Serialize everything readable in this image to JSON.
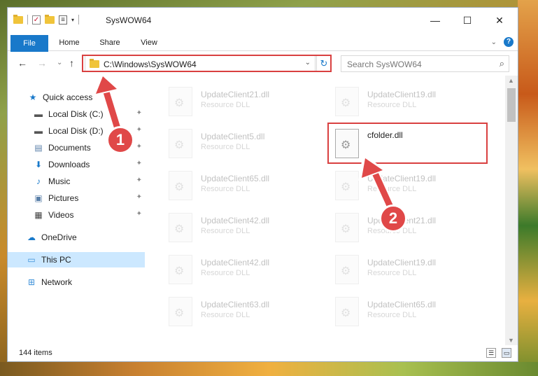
{
  "window": {
    "title": "SysWOW64",
    "minimize": "—",
    "maximize": "☐",
    "close": "✕"
  },
  "ribbon": {
    "tabs": [
      "File",
      "Home",
      "Share",
      "View"
    ],
    "expand": "⌄",
    "help": "?"
  },
  "nav": {
    "back": "←",
    "forward": "→",
    "recent": "⌄",
    "up": "↑",
    "address": "C:\\Windows\\SysWOW64",
    "address_dropdown": "⌄",
    "refresh": "↻",
    "search_placeholder": "Search SysWOW64",
    "search_icon": "⌕"
  },
  "sidebar": {
    "items": [
      {
        "label": "Quick access",
        "icon": "star-icon",
        "glyph": "★"
      },
      {
        "label": "Local Disk (C:)",
        "icon": "drive-icon",
        "glyph": "▬",
        "pin": "📌"
      },
      {
        "label": "Local Disk (D:)",
        "icon": "drive-icon",
        "glyph": "▬",
        "pin": "📌"
      },
      {
        "label": "Documents",
        "icon": "documents-icon",
        "glyph": "▤",
        "pin": "📌"
      },
      {
        "label": "Downloads",
        "icon": "download-icon",
        "glyph": "⬇",
        "pin": "📌"
      },
      {
        "label": "Music",
        "icon": "music-icon",
        "glyph": "♪",
        "pin": "📌"
      },
      {
        "label": "Pictures",
        "icon": "pictures-icon",
        "glyph": "▣",
        "pin": "📌"
      },
      {
        "label": "Videos",
        "icon": "videos-icon",
        "glyph": "▦",
        "pin": "📌"
      },
      {
        "label": "OneDrive",
        "icon": "cloud-icon",
        "glyph": "☁"
      },
      {
        "label": "This PC",
        "icon": "computer-icon",
        "glyph": "▭"
      },
      {
        "label": "Network",
        "icon": "network-icon",
        "glyph": "⊞"
      }
    ]
  },
  "files": {
    "left": [
      {
        "name": "UpdateClient21.dll",
        "type": "Resource DLL"
      },
      {
        "name": "UpdateClient5.dll",
        "type": "Resource DLL"
      },
      {
        "name": "UpdateClient65.dll",
        "type": "Resource DLL"
      },
      {
        "name": "UpdateClient42.dll",
        "type": "Resource DLL"
      },
      {
        "name": "UpdateClient42.dll",
        "type": "Resource DLL"
      },
      {
        "name": "UpdateClient63.dll",
        "type": "Resource DLL"
      }
    ],
    "right": [
      {
        "name": "UpdateClient19.dll",
        "type": "Resource DLL"
      },
      {
        "name": "cfolder.dll",
        "type": ""
      },
      {
        "name": "UpdateClient19.dll",
        "type": "Resource DLL"
      },
      {
        "name": "UpdateClient21.dll",
        "type": "Resource DLL"
      },
      {
        "name": "UpdateClient19.dll",
        "type": "Resource DLL"
      },
      {
        "name": "UpdateClient65.dll",
        "type": "Resource DLL"
      }
    ]
  },
  "status": {
    "item_count": "144 items"
  },
  "markers": {
    "one": "1",
    "two": "2"
  },
  "colors": {
    "accent": "#1979ca",
    "highlight": "#d94040"
  }
}
